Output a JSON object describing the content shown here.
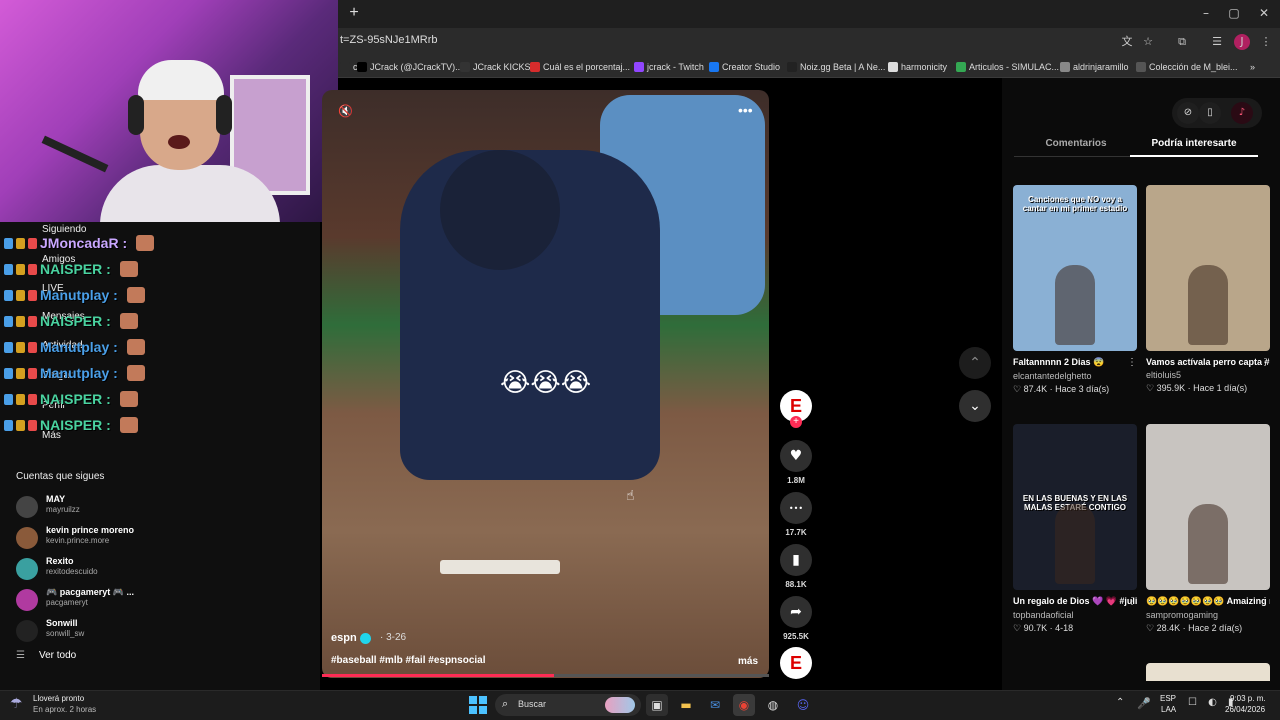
{
  "browser": {
    "new_tab": "+",
    "url": "t=ZS-95sNJe1MRrb",
    "window_controls": [
      "–",
      "▢",
      "✕"
    ],
    "bookmarks": [
      {
        "label": "ch",
        "color": "#2b2b2b"
      },
      {
        "label": "JCrack (@JCrackTV)...",
        "color": "#000000"
      },
      {
        "label": "JCrack KICKS",
        "color": "#333333"
      },
      {
        "label": "Cuál es el porcentaj...",
        "color": "#d62c2c"
      },
      {
        "label": "jcrack - Twitch",
        "color": "#9146ff"
      },
      {
        "label": "Creator Studio",
        "color": "#1877f2"
      },
      {
        "label": "Noiz.gg Beta | A Ne...",
        "color": "#222222"
      },
      {
        "label": "harmonicity",
        "color": "#dddddd"
      },
      {
        "label": "Articulos - SIMULAC...",
        "color": "#34a853"
      },
      {
        "label": "aldrinjaramillo",
        "color": "#888888"
      },
      {
        "label": "Colección de M_blei...",
        "color": "#555555"
      }
    ],
    "bookmarks_overflow": "»"
  },
  "sidebar": {
    "nav": [
      "Siguiendo",
      "Amigos",
      "LIVE",
      "Mensajes",
      "Actividad",
      "Cargar",
      "Perfil",
      "Más"
    ],
    "chat": [
      {
        "name": "JMoncadaR :",
        "color": "#c9a7ff"
      },
      {
        "name": "NAISPER :",
        "color": "#4ad3a0"
      },
      {
        "name": "Manutplay :",
        "color": "#4a9fe8"
      },
      {
        "name": "NAISPER :",
        "color": "#4ad3a0"
      },
      {
        "name": "Manutplay :",
        "color": "#4a9fe8"
      },
      {
        "name": "Manutplay :",
        "color": "#4a9fe8"
      },
      {
        "name": "NAISPER :",
        "color": "#4ad3a0"
      },
      {
        "name": "NAISPER :",
        "color": "#4ad3a0"
      }
    ],
    "follows_title": "Cuentas que sigues",
    "follows": [
      {
        "name": "MAY",
        "user": "mayruilzz",
        "color": "#444444"
      },
      {
        "name": "kevin prince moreno",
        "user": "kevin.prince.more",
        "color": "#8a5a3a"
      },
      {
        "name": "Rexito",
        "user": "rexitodescuido",
        "color": "#3aa0a0"
      },
      {
        "name": "🎮 pacgameryt 🎮 ...",
        "user": "pacgameryt",
        "color": "#b03aa0"
      },
      {
        "name": "Sonwill",
        "user": "sonwill_sw",
        "color": "#222222"
      }
    ],
    "see_all": "Ver todo",
    "see_all_icon": "☰"
  },
  "video": {
    "emoji": "😭😭😭",
    "more": "•••",
    "volume_icon": "🔇",
    "author": "espn",
    "date": "· 3-26",
    "tags": "#baseball #mlb #fail #espnsocial",
    "more_label": "más",
    "progress": 0.52
  },
  "actions": {
    "creator_initial": "E",
    "follow_plus": "+",
    "like_icon": "♥",
    "likes": "1.8M",
    "comment_icon": "•••",
    "comments": "17.7K",
    "bookmark_icon": "▮",
    "bookmarks": "88.1K",
    "share_icon": "➦",
    "shares": "925.5K",
    "sound_initial": "E",
    "nav_up": "⌃",
    "nav_down": "⌄"
  },
  "right_panel": {
    "icons": [
      "⊘",
      "▯",
      "♪"
    ],
    "tabs": [
      "Comentarios",
      "Podría interesarte"
    ],
    "cards": [
      {
        "title": "Faltannnnn 2 Dias 😨",
        "user": "elcantantedelghetto",
        "meta": "♡ 87.4K · Hace 3 día(s)",
        "thumb_color": "#8ab0d4",
        "thumb_text": "Canciones que NO voy a cantar en mi primer estadio"
      },
      {
        "title": "Vamos actívala perro capta #eltioluishnviral...",
        "user": "eltioluis5",
        "meta": "♡ 395.9K · Hace 1 día(s)",
        "thumb_color": "#b9a68a",
        "thumb_text": ""
      },
      {
        "title": "Un regalo de Dios 💜 💗 #julionalvarez #fy...",
        "user": "topbandaoficial",
        "meta": "♡ 90.7K · 4-18",
        "thumb_color": "#1a1e2a",
        "thumb_text": "EN LAS BUENAS Y EN LAS MALAS ESTARÉ CONTIGO"
      },
      {
        "title": "🥹🥹🥹🥹🥹🥹🥹 Amaizing moment 🥹🥹...",
        "user": "sampromogaming",
        "meta": "♡ 28.4K · Hace 2 día(s)",
        "thumb_color": "#c8c4c0",
        "thumb_text": ""
      }
    ],
    "card_more": "⋮"
  },
  "taskbar": {
    "weather_icon": "☂",
    "weather_title": "Lloverá pronto",
    "weather_sub": "En aprox. 2 horas",
    "search_label": "Buscar",
    "search_icon": "⌕",
    "apps": [
      {
        "icon": "▣",
        "color": "#ddd",
        "bg": "#2e2e2e"
      },
      {
        "icon": "▬",
        "color": "#f2c14e",
        "bg": "transparent"
      },
      {
        "icon": "✉",
        "color": "#4a90e2",
        "bg": "transparent"
      },
      {
        "icon": "◉",
        "color": "#ea4335",
        "bg": "#3a3a3a"
      },
      {
        "icon": "◍",
        "color": "#ddd",
        "bg": "transparent"
      },
      {
        "icon": "☺",
        "color": "#5865f2",
        "bg": "transparent"
      }
    ],
    "tray_chevron": "⌃",
    "tray_mic": "🎤",
    "lang1": "ESP",
    "lang2": "LAA",
    "tray_icons": "☐ ◐ ▮",
    "time": "9:03 p. m.",
    "date": "26/04/2026"
  }
}
